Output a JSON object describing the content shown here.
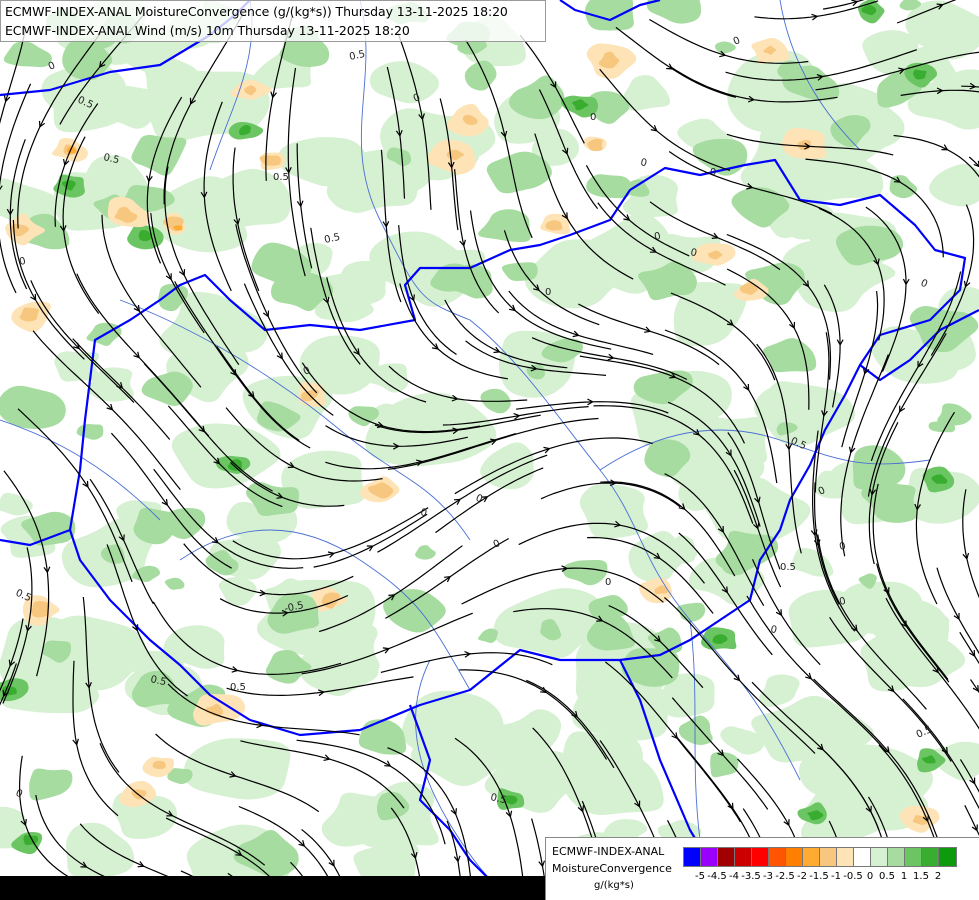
{
  "header": {
    "line1": "ECMWF-INDEX-ANAL MoistureConvergence (g/(kg*s)) Thursday 13-11-2025 18:20",
    "line2": "ECMWF-INDEX-ANAL Wind (m/s) 10m Thursday 13-11-2025 18:20"
  },
  "legend": {
    "title_line1": "ECMWF-INDEX-ANAL",
    "title_line2": "MoistureConvergence",
    "unit": "g/(kg*s)",
    "classes": [
      {
        "color": "#0000ff"
      },
      {
        "color": "#9b00ff"
      },
      {
        "color": "#a00000"
      },
      {
        "color": "#cc0000"
      },
      {
        "color": "#ff0000"
      },
      {
        "color": "#ff5500"
      },
      {
        "color": "#ff8000"
      },
      {
        "color": "#ffaa33"
      },
      {
        "color": "#f7c77f"
      },
      {
        "color": "#fde3b5"
      },
      {
        "color": "#ffffff"
      },
      {
        "color": "#d6f0d2"
      },
      {
        "color": "#a6dca0"
      },
      {
        "color": "#6cc563"
      },
      {
        "color": "#38ad2f"
      },
      {
        "color": "#0d9a0d"
      }
    ],
    "tick_labels": [
      "-5",
      "-4.5",
      "-4",
      "-3.5",
      "-3",
      "-2.5",
      "-2",
      "-1.5",
      "-1",
      "-0.5",
      "0",
      "0.5",
      "1",
      "1.5",
      "2"
    ]
  },
  "contour_labels": [
    "0",
    "0.5",
    "-0.5"
  ],
  "colors": {
    "border": "#0000ff",
    "river": "#4a6fd4",
    "streamline": "#000000",
    "conv_light": "#d6f0d2",
    "conv_mid": "#a6dca0",
    "conv_high": "#6cc563",
    "conv_max": "#38ad2f",
    "div_light": "#fde3b5",
    "div_mid": "#f7c77f",
    "div_high": "#ffaa33"
  }
}
